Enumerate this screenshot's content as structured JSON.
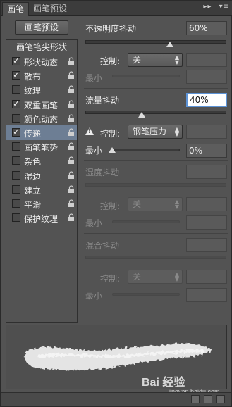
{
  "tabs": [
    {
      "label": "画笔",
      "active": true
    },
    {
      "label": "画笔预设",
      "active": false
    }
  ],
  "tab_tools": {
    "collapse_icon": "double-chevron-right",
    "menu_icon": "panel-menu"
  },
  "preset_button": "画笔预设",
  "list_header": "画笔笔尖形状",
  "items": [
    {
      "label": "形状动态",
      "checked": true,
      "selected": false
    },
    {
      "label": "散布",
      "checked": true,
      "selected": false
    },
    {
      "label": "纹理",
      "checked": false,
      "selected": false
    },
    {
      "label": "双重画笔",
      "checked": true,
      "selected": false
    },
    {
      "label": "颜色动态",
      "checked": false,
      "selected": false
    },
    {
      "label": "传递",
      "checked": true,
      "selected": true
    },
    {
      "label": "画笔笔势",
      "checked": false,
      "selected": false
    },
    {
      "label": "杂色",
      "checked": false,
      "selected": false
    },
    {
      "label": "湿边",
      "checked": false,
      "selected": false
    },
    {
      "label": "建立",
      "checked": false,
      "selected": false
    },
    {
      "label": "平滑",
      "checked": false,
      "selected": false
    },
    {
      "label": "保护纹理",
      "checked": false,
      "selected": false
    }
  ],
  "opacity_jitter": {
    "label": "不透明度抖动",
    "value": "60%",
    "slider_fraction": 0.6,
    "control_label": "控制:",
    "control_value": "关",
    "min_label": "最小"
  },
  "flow_jitter": {
    "label": "流量抖动",
    "value": "40%",
    "slider_fraction": 0.4,
    "control_label": "控制:",
    "control_value": "钢笔压力",
    "min_label": "最小",
    "min_value": "0%",
    "min_fraction": 0.0
  },
  "wetness_jitter": {
    "label": "湿度抖动",
    "control_label": "控制:",
    "control_value": "关",
    "min_label": "最小"
  },
  "mix_jitter": {
    "label": "混合抖动",
    "control_label": "控制:",
    "control_value": "关",
    "min_label": "最小"
  },
  "watermark": {
    "text": "Bai 经验",
    "sub": "jingyan.baidu.com"
  },
  "colors": {
    "panel": "#535353",
    "selection": "#6d7e94",
    "focus": "#5d93d6"
  }
}
